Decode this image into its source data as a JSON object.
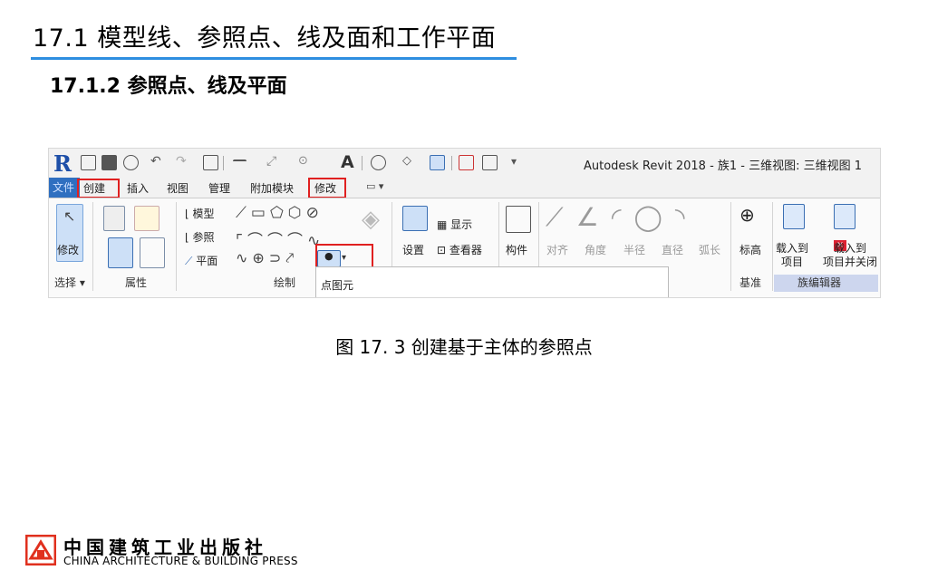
{
  "slide": {
    "title": "17.1 模型线、参照点、线及面和工作平面",
    "subtitle": "17.1.2   参照点、线及平面",
    "caption": "图 17. 3 创建基于主体的参照点"
  },
  "screenshot": {
    "app_title": "Autodesk Revit 2018 -    族1 - 三维视图: 三维视图 1",
    "tabs": [
      "文件",
      "创建",
      "插入",
      "视图",
      "管理",
      "附加模块",
      "修改"
    ],
    "buttons": {
      "modify": "修改",
      "model": "模型",
      "reference": "参照",
      "plane": "平面",
      "show": "显示",
      "set": "设置",
      "viewer": "查看器",
      "component": "构件",
      "align": "对齐",
      "angle": "角度",
      "radius": "半径",
      "diameter": "直径",
      "arc_length": "弧长",
      "elevation": "标高",
      "load_to_project": "载入到\n项目",
      "load_to_project_close": "载入到\n项目并关闭"
    },
    "panels": [
      "选择 ▾",
      "属性",
      "绘制",
      "基准",
      "族编辑器"
    ],
    "tooltip": "点图元",
    "highlight_color": "#e02020",
    "accent_color": "#2e8ee0"
  },
  "publisher": {
    "name_cn": "中国建筑工业出版社",
    "name_en": "CHINA ARCHITECTURE & BUILDING PRESS",
    "logo_color": "#e0301e"
  }
}
